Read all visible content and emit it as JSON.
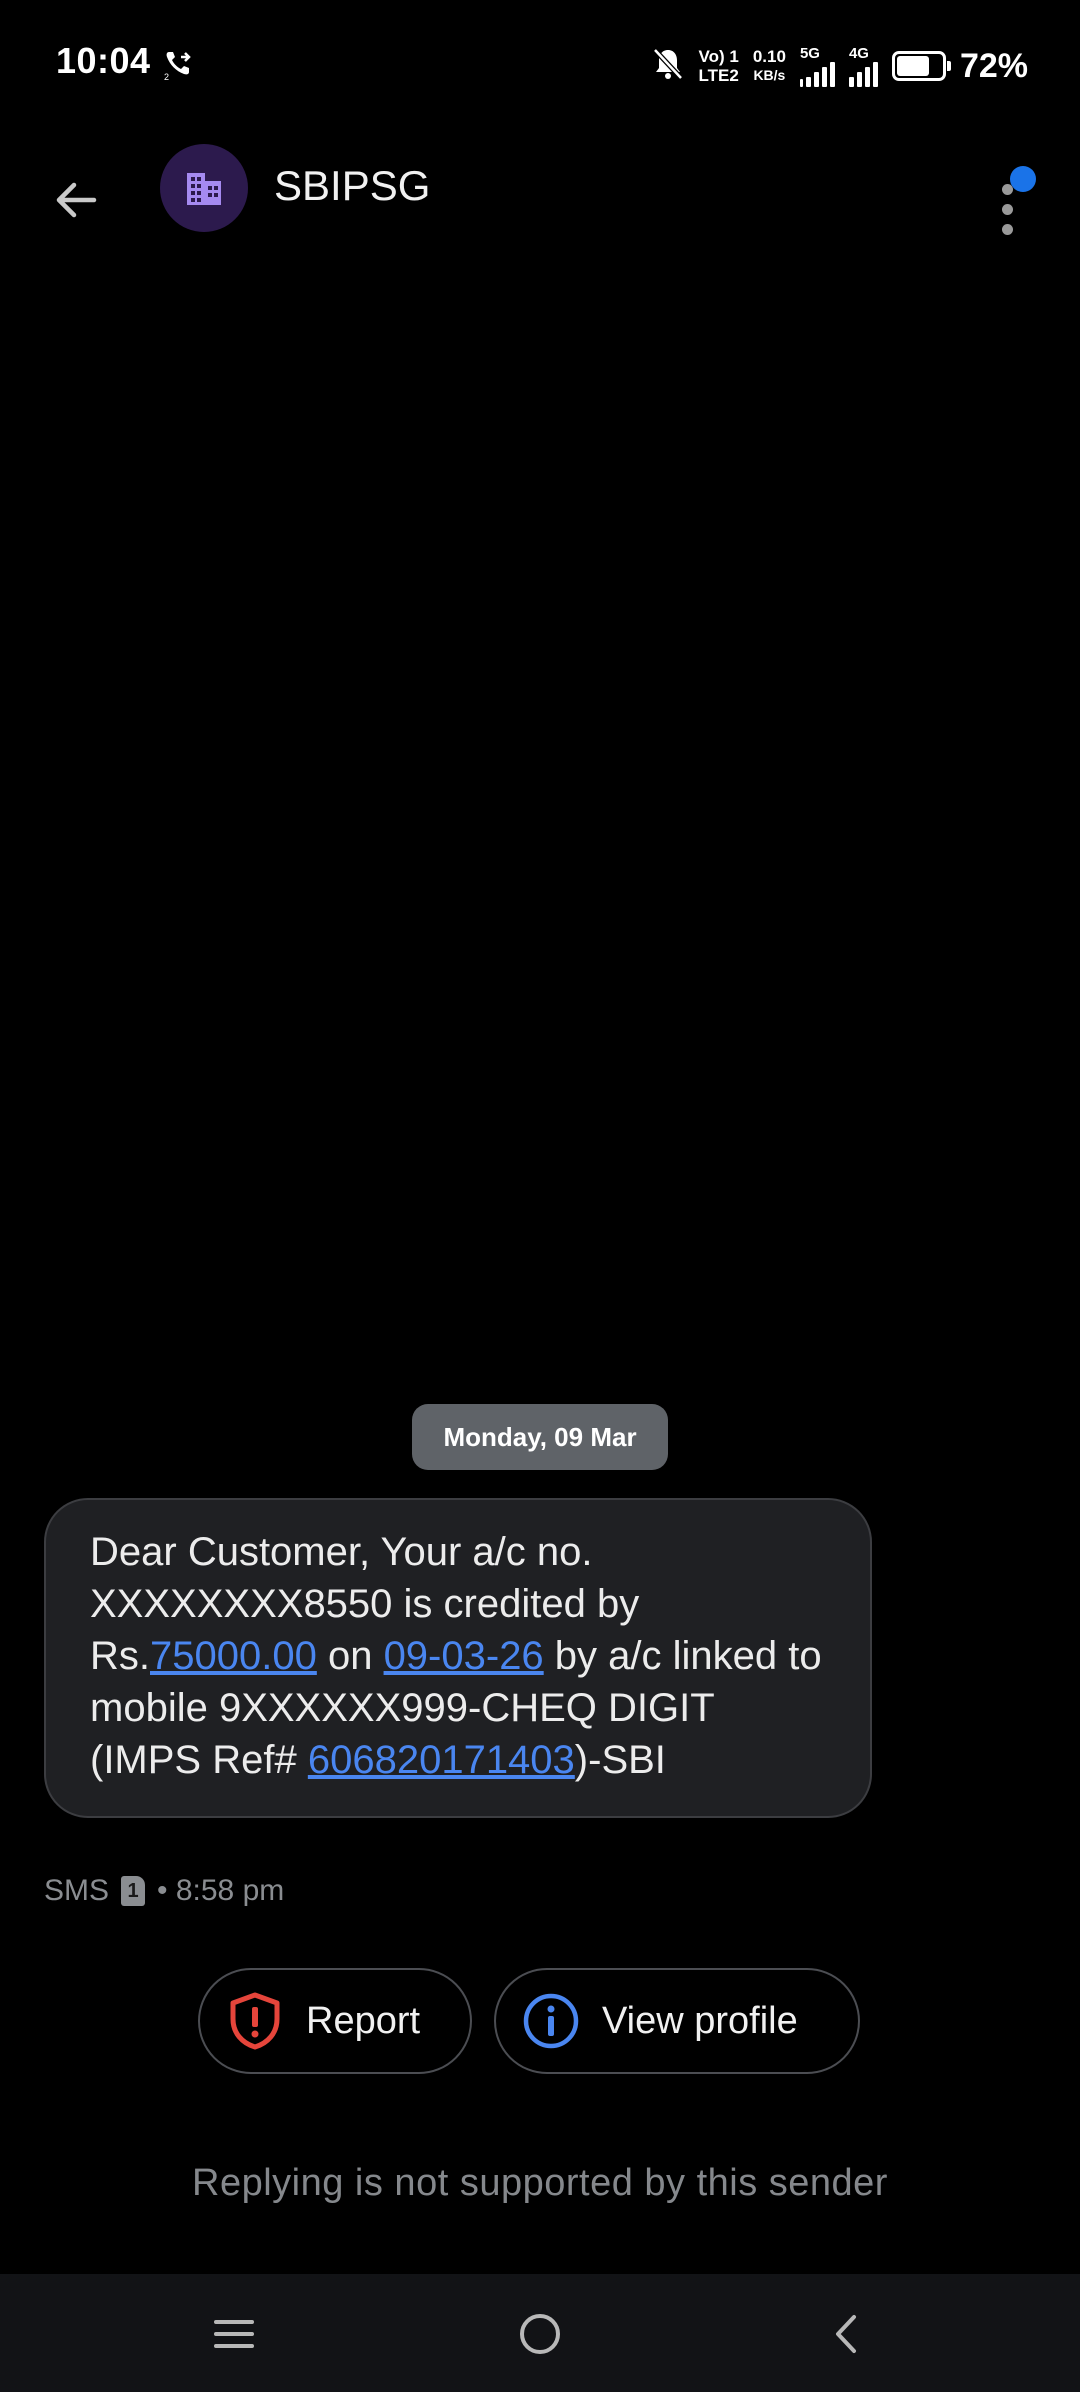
{
  "status_bar": {
    "time": "10:04",
    "volte_top": "Vo) 1",
    "volte_bottom": "LTE2",
    "net_speed_value": "0.10",
    "net_speed_unit": "KB/s",
    "network_5g": "5G",
    "network_4g": "4G",
    "battery_percent": "72%",
    "battery_level": 0.72
  },
  "header": {
    "sender_name": "SBIPSG",
    "avatar_icon": "building-icon",
    "accent_color": "#1a73e8"
  },
  "conversation": {
    "date_label": "Monday, 09 Mar",
    "message": {
      "part1": "Dear Customer, Your a/c no. XXXXXXXX8550 is credited by Rs.",
      "amount_link": "75000.00",
      "part2": " on ",
      "date_link": "09-03-26",
      "part3": " by a/c linked to mobile 9XXXXXX999-CHEQ DIGIT (IMPS Ref# ",
      "ref_link": "606820171403",
      "part4": ")-SBI"
    },
    "meta_type": "SMS",
    "sim_slot": "1",
    "meta_time": "• 8:58 pm"
  },
  "actions": {
    "report_label": "Report",
    "view_profile_label": "View profile"
  },
  "reply_note": "Replying is not supported by this sender"
}
